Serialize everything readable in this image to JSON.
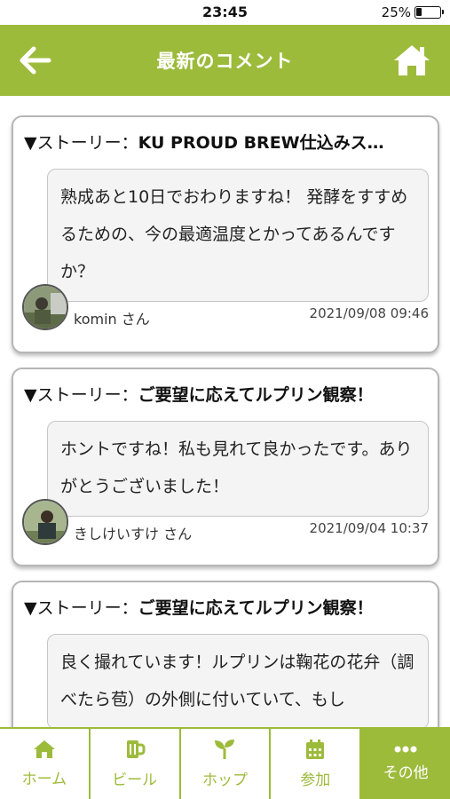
{
  "status_bar": {
    "time": "23:45",
    "battery": "25%"
  },
  "header": {
    "title": "最新のコメント",
    "back_icon": "back-arrow-icon",
    "home_icon": "home-icon"
  },
  "comments": [
    {
      "story_prefix": "▼ストーリー：",
      "story_title": "KU PROUD BREW仕込みス…",
      "text": "熟成あと10日でおわりますね！ 発酵をすすめるための、今の最適温度とかってあるんですか？",
      "user": "komin さん",
      "date": "2021/09/08 09:46"
    },
    {
      "story_prefix": "▼ストーリー：",
      "story_title": "ご要望に応えてルプリン観察！",
      "text": "ホントですね！私も見れて良かったです。ありがとうございました！",
      "user": "きしけいすけ さん",
      "date": "2021/09/04 10:37"
    },
    {
      "story_prefix": "▼ストーリー：",
      "story_title": "ご要望に応えてルプリン観察！",
      "text": "良く撮れています！ルプリンは鞠花の花弁（調べたら苞）の外側に付いていて、もし",
      "user": "",
      "date": ""
    }
  ],
  "tabs": [
    {
      "label": "ホーム",
      "icon": "home-icon",
      "active": false
    },
    {
      "label": "ビール",
      "icon": "beer-mug-icon",
      "active": false
    },
    {
      "label": "ホップ",
      "icon": "sprout-icon",
      "active": false
    },
    {
      "label": "参加",
      "icon": "calendar-icon",
      "active": false
    },
    {
      "label": "その他",
      "icon": "more-dots-icon",
      "active": true
    }
  ],
  "colors": {
    "brand_green": "#9dbb3b",
    "white": "#ffffff"
  }
}
